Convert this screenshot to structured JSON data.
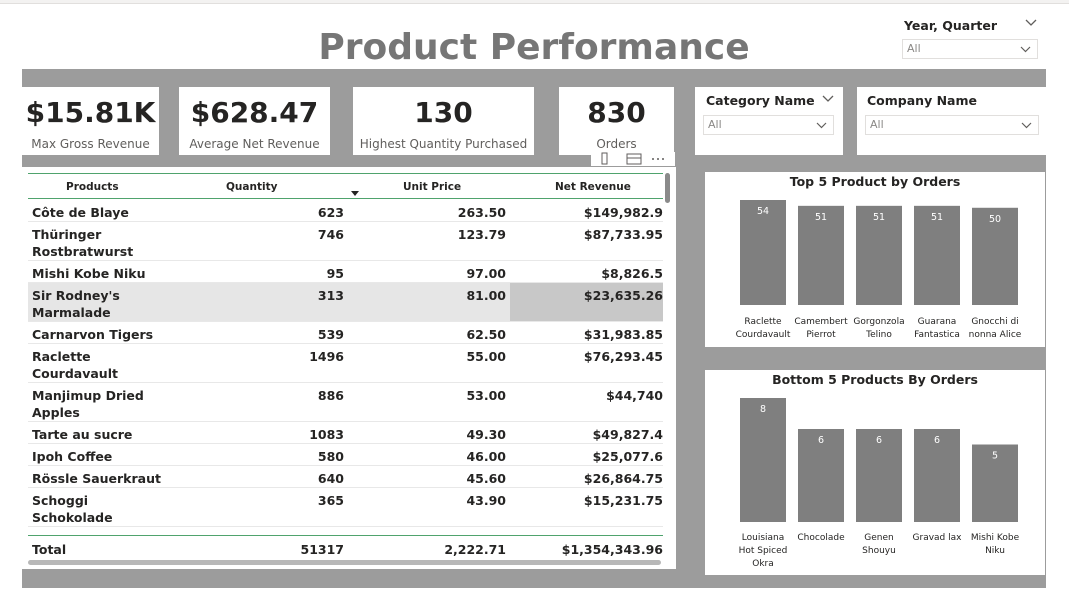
{
  "title": "Product Performance",
  "slicers": {
    "year_quarter": {
      "title": "Year, Quarter",
      "value": "All"
    },
    "category": {
      "title": "Category Name",
      "value": "All"
    },
    "company": {
      "title": "Company Name",
      "value": "All"
    }
  },
  "cards": [
    {
      "value": "$15.81K",
      "label": "Max Gross Revenue"
    },
    {
      "value": "$628.47",
      "label": "Average Net Revenue"
    },
    {
      "value": "130",
      "label": "Highest Quantity Purchased"
    },
    {
      "value": "830",
      "label": "Orders"
    }
  ],
  "table": {
    "columns": [
      "Products",
      "Quantity",
      "Unit Price",
      "Net Revenue"
    ],
    "sort_column": "Unit Price",
    "rows": [
      {
        "product": "Côte de Blaye",
        "product_line2": "",
        "quantity": "623",
        "unit_price": "263.50",
        "net_revenue": "$149,982.9"
      },
      {
        "product": "Thüringer",
        "product_line2": "Rostbratwurst",
        "quantity": "746",
        "unit_price": "123.79",
        "net_revenue": "$87,733.95"
      },
      {
        "product": "Mishi Kobe Niku",
        "product_line2": "",
        "quantity": "95",
        "unit_price": "97.00",
        "net_revenue": "$8,826.5"
      },
      {
        "product": "Sir Rodney's",
        "product_line2": "Marmalade",
        "quantity": "313",
        "unit_price": "81.00",
        "net_revenue": "$23,635.26"
      },
      {
        "product": "Carnarvon Tigers",
        "product_line2": "",
        "quantity": "539",
        "unit_price": "62.50",
        "net_revenue": "$31,983.85"
      },
      {
        "product": "Raclette",
        "product_line2": "Courdavault",
        "quantity": "1496",
        "unit_price": "55.00",
        "net_revenue": "$76,293.45"
      },
      {
        "product": "Manjimup Dried",
        "product_line2": "Apples",
        "quantity": "886",
        "unit_price": "53.00",
        "net_revenue": "$44,740"
      },
      {
        "product": "Tarte au sucre",
        "product_line2": "",
        "quantity": "1083",
        "unit_price": "49.30",
        "net_revenue": "$49,827.4"
      },
      {
        "product": "Ipoh Coffee",
        "product_line2": "",
        "quantity": "580",
        "unit_price": "46.00",
        "net_revenue": "$25,077.6"
      },
      {
        "product": "Rössle Sauerkraut",
        "product_line2": "",
        "quantity": "640",
        "unit_price": "45.60",
        "net_revenue": "$26,864.75"
      },
      {
        "product": "Schoggi",
        "product_line2": "Schokolade",
        "quantity": "365",
        "unit_price": "43.90",
        "net_revenue": "$15,231.75"
      }
    ],
    "total": {
      "label": "Total",
      "quantity": "51317",
      "unit_price": "2,222.71",
      "net_revenue": "$1,354,343.96"
    }
  },
  "chart_data": [
    {
      "type": "bar",
      "title": "Top 5 Product by Orders",
      "categories": [
        "Raclette Courdavault",
        "Camembert Pierrot",
        "Gorgonzola Telino",
        "Guarana Fantastica",
        "Gnocchi di nonna Alice"
      ],
      "values": [
        54,
        51,
        51,
        51,
        50
      ],
      "bar_color": "#7f7f7f"
    },
    {
      "type": "bar",
      "title": "Bottom 5 Products By Orders",
      "categories": [
        "Louisiana Hot Spiced Okra",
        "Chocolade",
        "Genen Shouyu",
        "Gravad lax",
        "Mishi Kobe Niku"
      ],
      "values": [
        8,
        6,
        6,
        6,
        5
      ],
      "bar_color": "#7f7f7f"
    }
  ],
  "colors": {
    "canvas": "#9c9c9c",
    "title": "#767676",
    "table_accent": "#4fa36d",
    "bar": "#7f7f7f"
  }
}
